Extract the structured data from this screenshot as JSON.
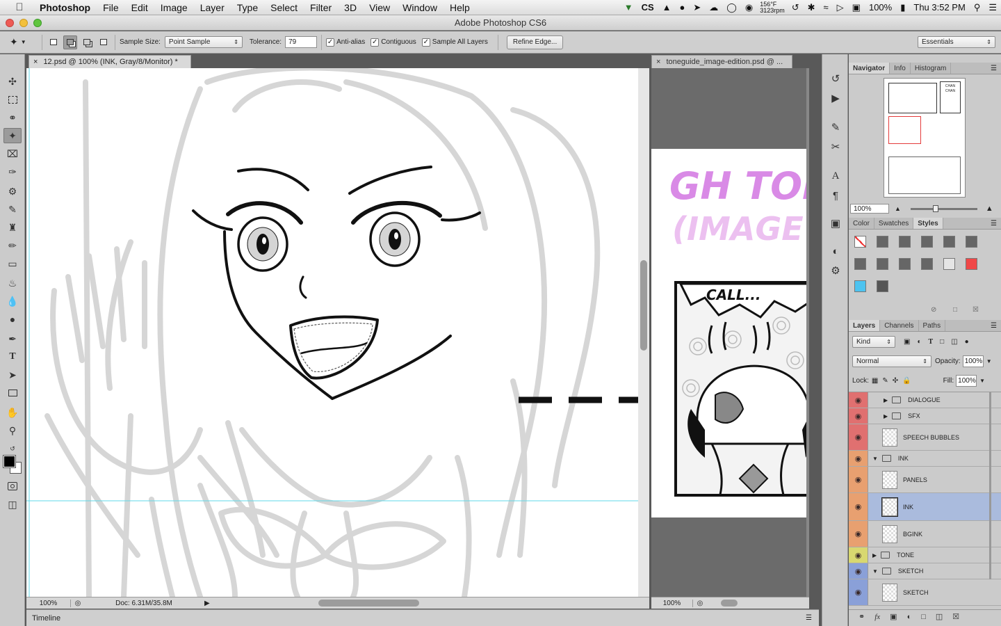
{
  "menubar": {
    "app": "Photoshop",
    "items": [
      "File",
      "Edit",
      "Image",
      "Layer",
      "Type",
      "Select",
      "Filter",
      "3D",
      "View",
      "Window",
      "Help"
    ],
    "tray": {
      "cs": "CS",
      "temp": "156°F",
      "rpm": "3123rpm",
      "battery": "100%",
      "clock": "Thu 3:52 PM"
    }
  },
  "titlebar": {
    "title": "Adobe Photoshop CS6"
  },
  "options": {
    "sample_size_label": "Sample Size:",
    "sample_size_value": "Point Sample",
    "tolerance_label": "Tolerance:",
    "tolerance_value": "79",
    "antialias": "Anti-alias",
    "contiguous": "Contiguous",
    "sample_all": "Sample All Layers",
    "refine_edge": "Refine Edge...",
    "workspace": "Essentials"
  },
  "doc1": {
    "tab": "12.psd @ 100% (INK, Gray/8/Monitor) *",
    "zoom": "100%",
    "doc_info": "Doc: 6.31M/35.8M"
  },
  "doc2": {
    "tab": "toneguide_image-edition.psd @ ...",
    "zoom": "100%",
    "title_line1": "GH TONE",
    "title_line2": "(IMAGE E",
    "bubble": "CALL..."
  },
  "timeline": {
    "label": "Timeline"
  },
  "navigator": {
    "tabs": [
      "Navigator",
      "Info",
      "Histogram"
    ],
    "zoom": "100%",
    "thumb_text": "CHAN CHAN"
  },
  "color_panel": {
    "tabs": [
      "Color",
      "Swatches",
      "Styles"
    ]
  },
  "layers_panel": {
    "tabs": [
      "Layers",
      "Channels",
      "Paths"
    ],
    "kind": "Kind",
    "blend": "Normal",
    "opacity_label": "Opacity:",
    "opacity": "100%",
    "lock_label": "Lock:",
    "fill_label": "Fill:",
    "fill": "100%",
    "layers": [
      {
        "name": "DIALOGUE",
        "type": "folder",
        "color": "#e07070",
        "indent": 1
      },
      {
        "name": "SFX",
        "type": "folder",
        "color": "#e07070",
        "indent": 1
      },
      {
        "name": "SPEECH BUBBLES",
        "type": "layer",
        "color": "#e07070",
        "indent": 0
      },
      {
        "name": "INK",
        "type": "folder-open",
        "color": "#e8a070",
        "indent": 0
      },
      {
        "name": "PANELS",
        "type": "layer",
        "color": "#e8a070",
        "indent": 0
      },
      {
        "name": "INK",
        "type": "layer",
        "color": "#e8a070",
        "indent": 0,
        "selected": true
      },
      {
        "name": "BGINK",
        "type": "layer",
        "color": "#e8a070",
        "indent": 0
      },
      {
        "name": "TONE",
        "type": "folder",
        "color": "#d8d870",
        "indent": 0
      },
      {
        "name": "SKETCH",
        "type": "folder-open",
        "color": "#8aa0d8",
        "indent": 0
      },
      {
        "name": "SKETCH",
        "type": "layer",
        "color": "#8aa0d8",
        "indent": 0
      }
    ]
  },
  "colors": {
    "accent": "#aabbdd",
    "fg": "#000000",
    "bg": "#ffffff"
  }
}
